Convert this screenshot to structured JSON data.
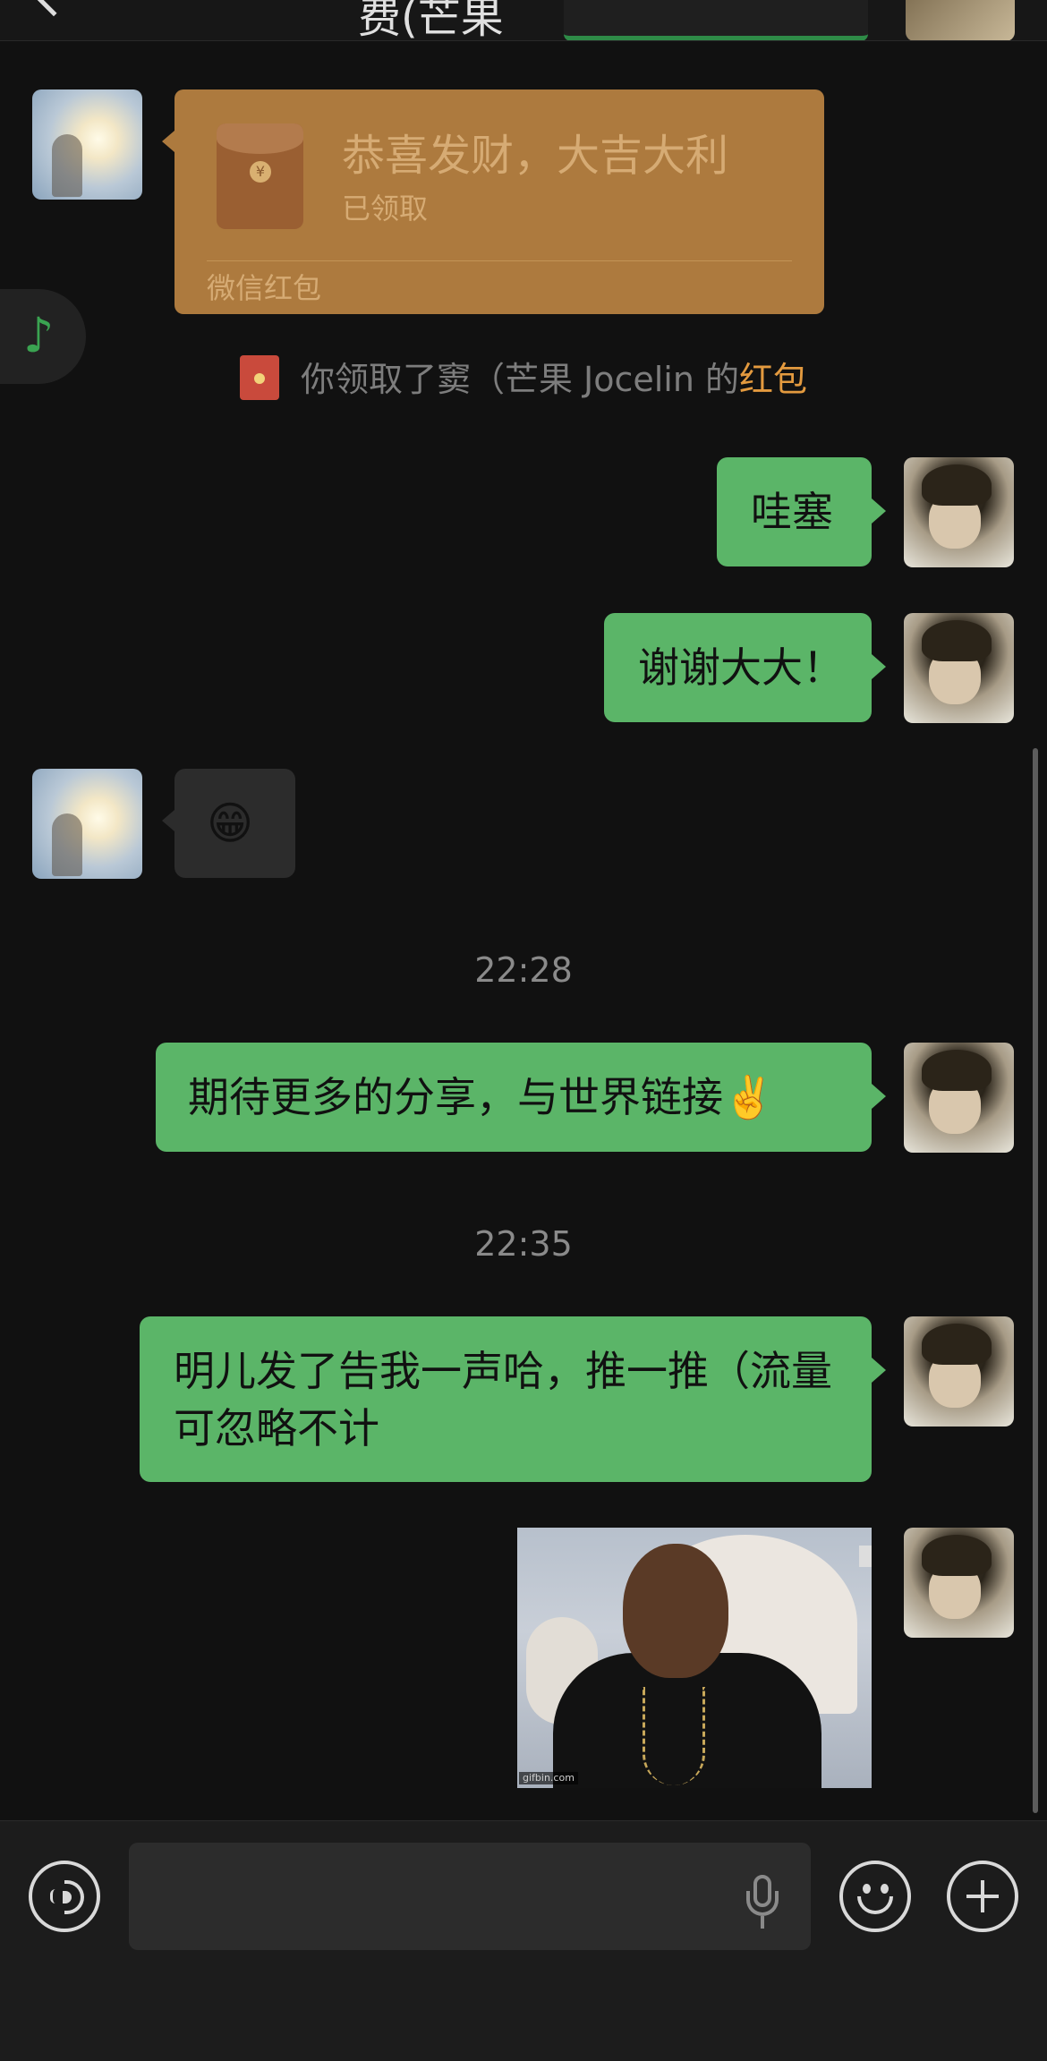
{
  "header": {
    "title_fragment": "费(芒果"
  },
  "red_packet": {
    "title": "恭喜发财，大吉大利",
    "status": "已领取",
    "footer": "微信红包"
  },
  "floating_widget": {
    "icon": "music-note-icon",
    "glyph": "♪"
  },
  "system_notice": {
    "text": "你领取了窦（芒果 Jocelin 的",
    "link": "红包"
  },
  "messages": [
    {
      "side": "right",
      "text": "哇塞"
    },
    {
      "side": "right",
      "text": "谢谢大大！"
    },
    {
      "side": "left",
      "text": "😁"
    },
    {
      "side": "right",
      "text": "期待更多的分享，与世界链接✌️"
    },
    {
      "side": "right",
      "text": "明儿发了告我一声哈，推一推（流量可忽略不计"
    },
    {
      "side": "right",
      "type": "image",
      "watermark": "gifbin.com"
    }
  ],
  "timestamps": [
    "22:28",
    "22:35"
  ],
  "input_bar": {
    "placeholder": "",
    "icons": [
      "voice-icon",
      "microphone-icon",
      "emoji-icon",
      "plus-icon"
    ]
  },
  "colors": {
    "background": "#111111",
    "bubble_green": "#5bb568",
    "bubble_gray": "#2c2c2c",
    "red_packet": "#ad7a3e",
    "link_orange": "#e39a3f"
  }
}
